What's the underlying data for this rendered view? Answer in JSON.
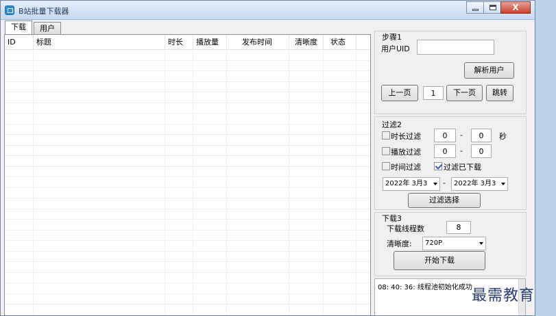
{
  "window": {
    "title": "B站批量下载器",
    "controls": {
      "minimize": "minimize-icon",
      "maximize": "maximize-icon",
      "close": "close-icon",
      "close_glyph": "X"
    }
  },
  "tabs": [
    {
      "label": "下载",
      "active": true
    },
    {
      "label": "用户",
      "active": false
    }
  ],
  "grid": {
    "columns": [
      "ID",
      "标题",
      "时长",
      "播放量",
      "发布时间",
      "清晰度",
      "状态"
    ],
    "rows": []
  },
  "step1": {
    "title": "步骤1",
    "uid_label": "用户UID",
    "uid_value": "",
    "parse_button": "解析用户",
    "prev_button": "上一页",
    "page_value": "1",
    "next_button": "下一页",
    "jump_button": "跳转"
  },
  "filter": {
    "title": "过滤2",
    "duration": {
      "label": "时长过滤",
      "checked": false,
      "min": "0",
      "dash": "-",
      "max": "0",
      "unit": "秒"
    },
    "play": {
      "label": "播放过滤",
      "checked": false,
      "min": "0",
      "dash": "-",
      "max": "0"
    },
    "time": {
      "label": "时间过滤",
      "checked": false
    },
    "downloaded": {
      "label": "过滤已下载",
      "checked": true
    },
    "date_from": "2022年 3月3",
    "date_dash": "-",
    "date_to": "2022年 3月3",
    "apply_button": "过滤选择"
  },
  "download": {
    "title": "下载3",
    "threads_label": "下载线程数",
    "threads_value": "8",
    "quality_label": "清晰度:",
    "quality_value": "720P",
    "start_button": "开始下载"
  },
  "log": {
    "lines": [
      "08: 40: 36: 线程池初始化成功"
    ]
  },
  "watermark": "最需教育",
  "colors": {
    "window_bg": "#f0f0f0",
    "titlebar": "#c6d9f1",
    "close_button": "#c7432c",
    "checkmark": "#2f5f9e"
  }
}
